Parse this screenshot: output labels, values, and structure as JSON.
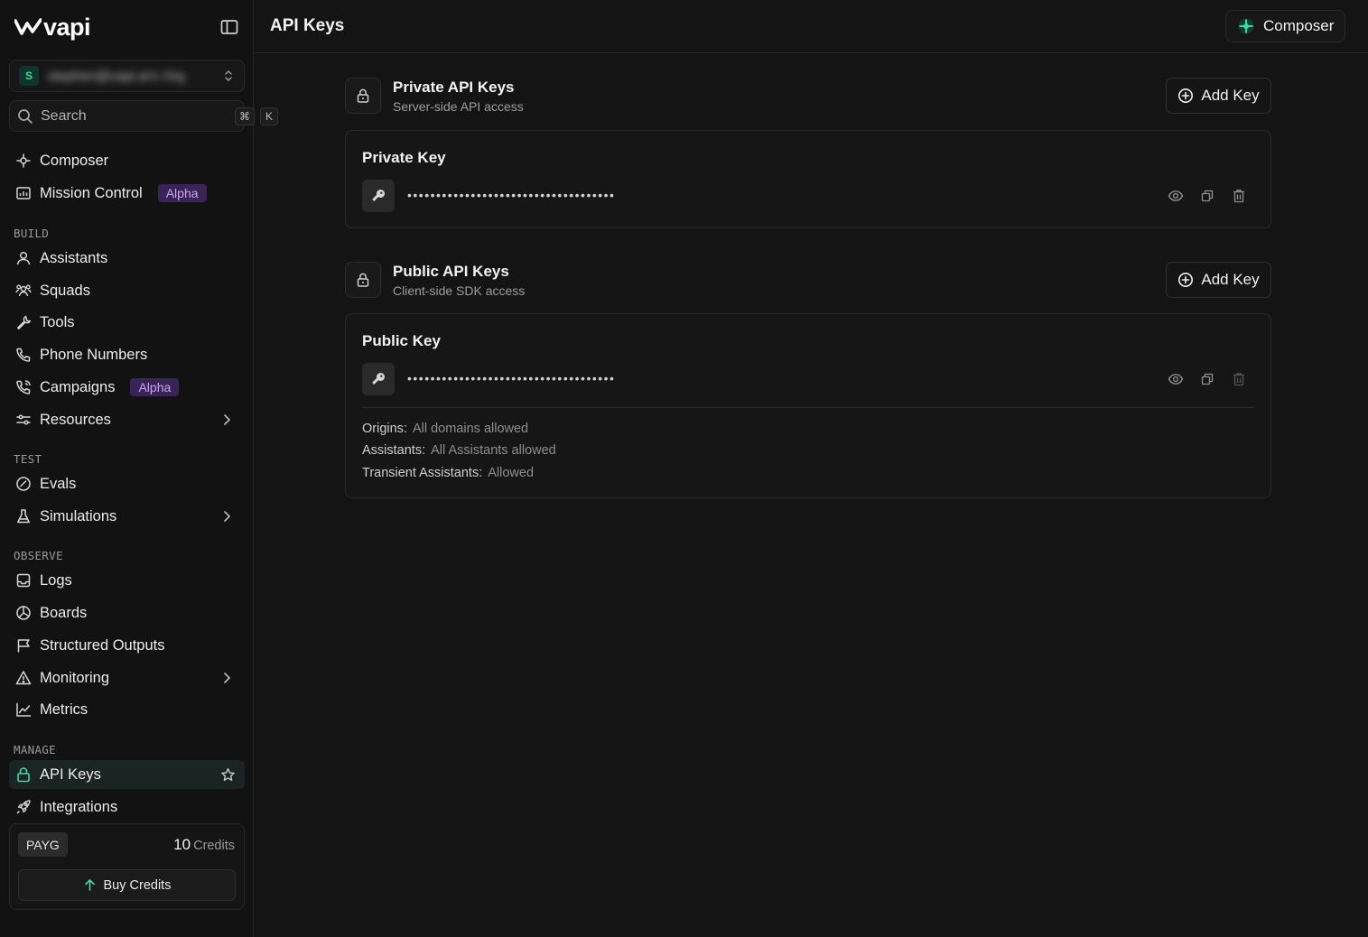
{
  "brand": {
    "name": "vapi"
  },
  "org": {
    "initial": "S",
    "name": "stephen@vapi.ai's Org"
  },
  "search": {
    "placeholder": "Search",
    "shortcut_mod": "⌘",
    "shortcut_key": "K"
  },
  "nav": {
    "top": [
      {
        "label": "Composer",
        "icon": "composer-icon"
      },
      {
        "label": "Mission Control",
        "icon": "dashboard-icon",
        "badge": "Alpha"
      }
    ],
    "build": {
      "title": "BUILD",
      "items": [
        {
          "label": "Assistants",
          "icon": "user-icon"
        },
        {
          "label": "Squads",
          "icon": "users-icon"
        },
        {
          "label": "Tools",
          "icon": "wrench-icon"
        },
        {
          "label": "Phone Numbers",
          "icon": "phone-icon"
        },
        {
          "label": "Campaigns",
          "icon": "phone-outgoing-icon",
          "badge": "Alpha"
        },
        {
          "label": "Resources",
          "icon": "sliders-icon"
        }
      ]
    },
    "test": {
      "title": "TEST",
      "items": [
        {
          "label": "Evals",
          "icon": "check-circle-icon"
        },
        {
          "label": "Simulations",
          "icon": "flask-icon"
        }
      ]
    },
    "observe": {
      "title": "OBSERVE",
      "items": [
        {
          "label": "Logs",
          "icon": "inbox-icon"
        },
        {
          "label": "Boards",
          "icon": "pie-icon"
        },
        {
          "label": "Structured Outputs",
          "icon": "flag-icon"
        },
        {
          "label": "Monitoring",
          "icon": "warning-icon"
        },
        {
          "label": "Metrics",
          "icon": "line-chart-icon"
        }
      ]
    },
    "manage": {
      "title": "MANAGE",
      "items": [
        {
          "label": "API Keys",
          "icon": "lock-icon",
          "active": true
        },
        {
          "label": "Integrations",
          "icon": "rocket-icon"
        }
      ]
    }
  },
  "billing": {
    "plan": "PAYG",
    "credits": "10",
    "credits_unit": "Credits",
    "buy_label": "Buy Credits"
  },
  "header": {
    "title": "API Keys",
    "composer_label": "Composer"
  },
  "private_section": {
    "title": "Private API Keys",
    "subtitle": "Server-side API access",
    "add_label": "Add Key",
    "key": {
      "title": "Private Key",
      "masked": "••••••••••••••••••••••••••••••••••••"
    }
  },
  "public_section": {
    "title": "Public API Keys",
    "subtitle": "Client-side SDK access",
    "add_label": "Add Key",
    "key": {
      "title": "Public Key",
      "masked": "••••••••••••••••••••••••••••••••••••",
      "origins_label": "Origins:",
      "origins_value": "All domains allowed",
      "assistants_label": "Assistants:",
      "assistants_value": "All Assistants allowed",
      "transient_label": "Transient Assistants:",
      "transient_value": "Allowed"
    }
  },
  "colors": {
    "accent": "#3fd9a4",
    "alpha_badge_bg": "#3a2357",
    "alpha_badge_text": "#c8a5f5",
    "bg": "#141414"
  }
}
